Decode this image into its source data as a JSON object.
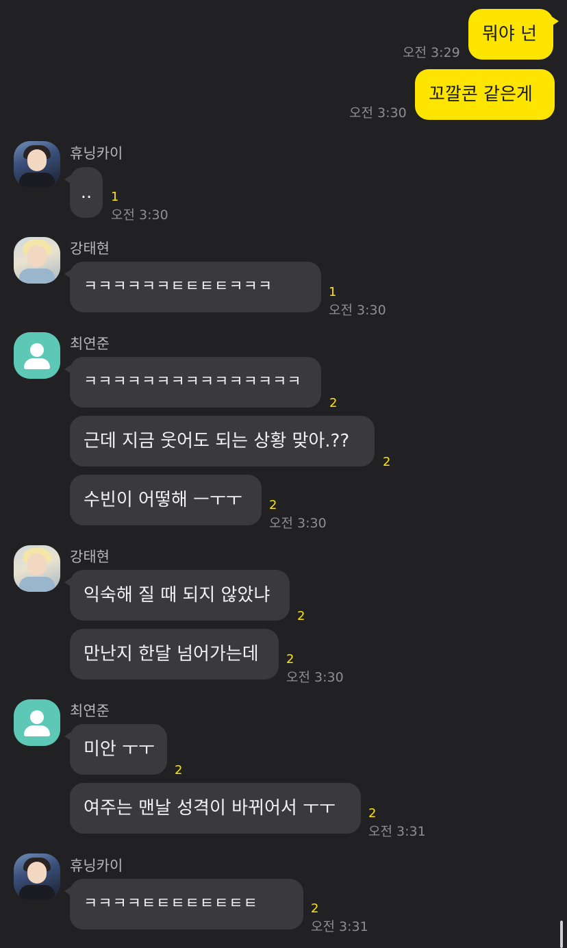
{
  "messages": {
    "m1": {
      "text": "뭐야 넌",
      "time": "오전 3:29"
    },
    "m2": {
      "text": "꼬깔콘 같은게",
      "time": "오전 3:30"
    },
    "g1": {
      "sender": "휴닝카이",
      "text": "..",
      "unread": "1",
      "time": "오전 3:30"
    },
    "g2": {
      "sender": "강태현",
      "text": "ㅋㅋㅋㅋㅋㅋㅌㅌㅌㅌㅋㅋㅋ",
      "unread": "1",
      "time": "오전 3:30"
    },
    "g3": {
      "sender": "최연준",
      "b1": {
        "text": "ㅋㅋㅋㅋㅋㅋㅋㅋㅋㅋㅋㅋㅋㅋㅋ",
        "unread": "2"
      },
      "b2": {
        "text": "근데 지금 웃어도 되는 상황 맞아.??",
        "unread": "2"
      },
      "b3": {
        "text": "수빈이 어떻해 ㅡㅜㅜ",
        "unread": "2",
        "time": "오전 3:30"
      }
    },
    "g4": {
      "sender": "강태현",
      "b1": {
        "text": "익숙해 질 때 되지 않았냐",
        "unread": "2"
      },
      "b2": {
        "text": "만난지 한달 넘어가는데",
        "unread": "2",
        "time": "오전 3:30"
      }
    },
    "g5": {
      "sender": "최연준",
      "b1": {
        "text": "미안 ㅜㅜ",
        "unread": "2"
      },
      "b2": {
        "text": "여주는 맨날 성격이 바뀌어서 ㅜㅜ",
        "unread": "2",
        "time": "오전 3:31"
      }
    },
    "g6": {
      "sender": "휴닝카이",
      "text": "ㅋㅋㅋㅋㅌㅌㅌㅌㅌㅌㅌㅌ",
      "unread": "2",
      "time": "오전 3:31"
    }
  },
  "colors": {
    "background": "#212123",
    "my_bubble": "#fee500",
    "other_bubble": "#3a3a3c",
    "unread": "#fee500",
    "default_avatar": "#5ec8b6"
  },
  "icons": {
    "photo_avatar": "profile-photo",
    "default_avatar": "person-icon"
  }
}
